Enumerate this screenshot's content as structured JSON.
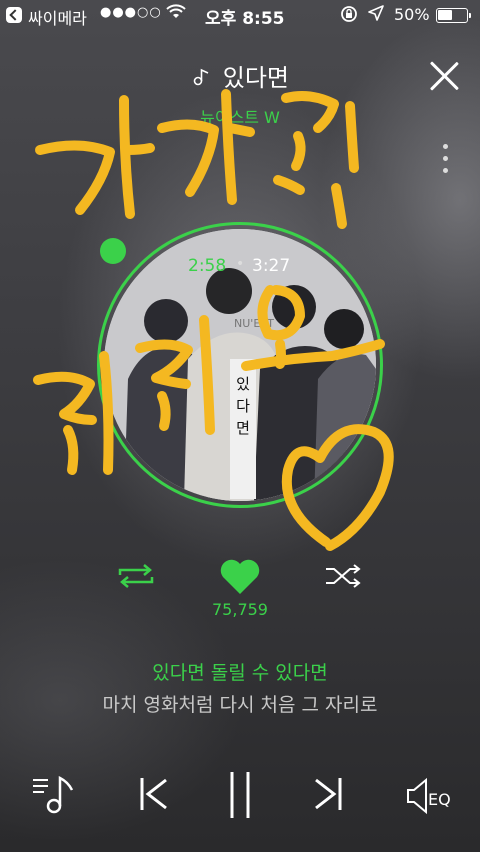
{
  "status_bar": {
    "carrier": "싸이메라",
    "signal_dots": "●●●○○",
    "time": "오후 8:55",
    "battery": "50%"
  },
  "player": {
    "title": "있다면",
    "artist": "뉴이스트 W",
    "time_current": "2:58",
    "time_separator": "•",
    "time_total": "3:27",
    "progress_fraction": 0.86,
    "like_count": "75,759",
    "lyric_current": "있다면 돌릴 수 있다면",
    "lyric_next": "마치 영화처럼 다시 처음 그 자리로",
    "album_caption": "있다면",
    "album_text": "NU'EST"
  },
  "overlay": {
    "handwriting": "가자 잔 리리오",
    "handwriting_color": "#f4b821"
  },
  "colors": {
    "accent": "#3bd14a",
    "text": "#ffffff",
    "muted": "#c8c8c8"
  },
  "icons": {
    "back": "back-chevron-icon",
    "wifi": "wifi-icon",
    "rotation_lock": "rotation-lock-icon",
    "location": "location-arrow-icon",
    "battery": "battery-icon",
    "music_note": "music-note-icon",
    "close": "close-icon",
    "more": "more-vertical-icon",
    "repeat": "repeat-icon",
    "heart": "heart-icon",
    "shuffle": "shuffle-icon",
    "playlist": "playlist-icon",
    "previous": "previous-track-icon",
    "pause": "pause-icon",
    "next": "next-track-icon",
    "equalizer": "equalizer-icon"
  },
  "eq_label": "EQ"
}
